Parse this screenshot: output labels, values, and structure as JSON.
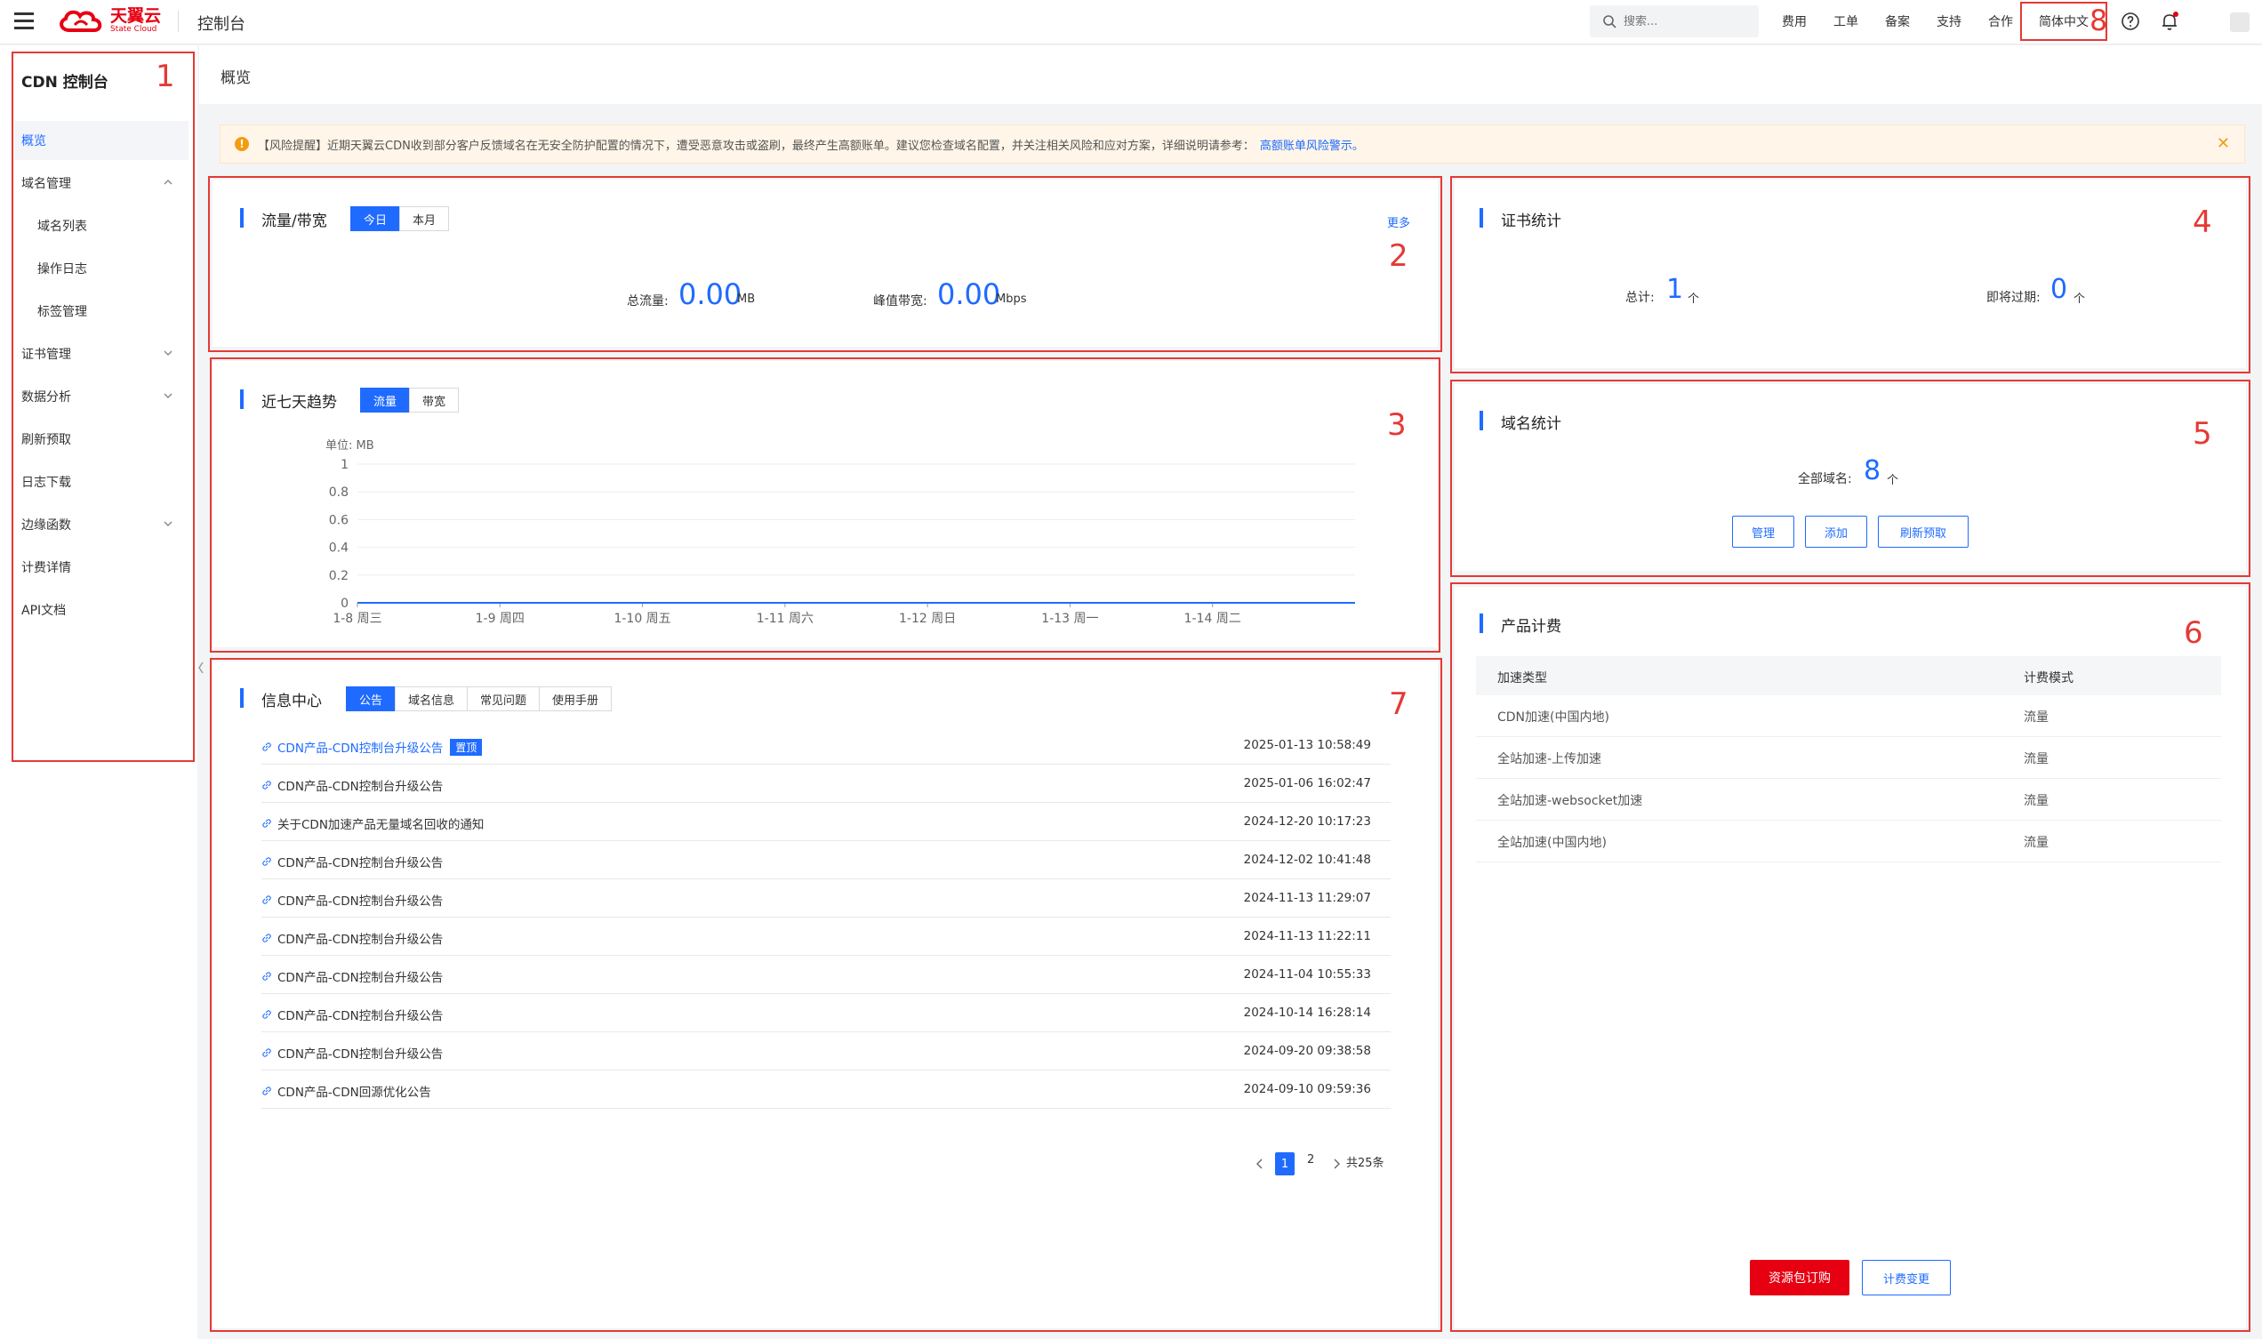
{
  "header": {
    "brand_cn": "天翼云",
    "brand_en": "State Cloud",
    "title": "控制台",
    "search_placeholder": "搜索...",
    "nav": [
      "费用",
      "工单",
      "备案",
      "支持",
      "合作"
    ],
    "language": "简体中文",
    "lang_annotation": "8"
  },
  "sidebar": {
    "title": "CDN 控制台",
    "annotation": "1",
    "items": [
      {
        "label": "概览",
        "active": true
      },
      {
        "label": "域名管理",
        "expanded": true
      },
      {
        "label": "域名列表",
        "sub": true
      },
      {
        "label": "操作日志",
        "sub": true
      },
      {
        "label": "标签管理",
        "sub": true
      },
      {
        "label": "证书管理",
        "expandable": true
      },
      {
        "label": "数据分析",
        "expandable": true
      },
      {
        "label": "刷新预取"
      },
      {
        "label": "日志下载"
      },
      {
        "label": "边缘函数",
        "expandable": true
      },
      {
        "label": "计费详情"
      },
      {
        "label": "API文档"
      }
    ]
  },
  "breadcrumb": "概览",
  "alert": {
    "text": "【风险提醒】近期天翼云CDN收到部分客户反馈域名在无安全防护配置的情况下，遭受恶意攻击或盗刷，最终产生高额账单。建议您检查域名配置，并关注相关风险和应对方案，详细说明请参考：",
    "link": "高额账单风险警示。"
  },
  "traffic": {
    "title": "流量/带宽",
    "annotation": "2",
    "tabs": [
      "今日",
      "本月"
    ],
    "more": "更多",
    "total_label": "总流量:",
    "total_value": "0.00",
    "total_unit": "MB",
    "peak_label": "峰值带宽:",
    "peak_value": "0.00",
    "peak_unit": "Mbps"
  },
  "trend": {
    "title": "近七天趋势",
    "annotation": "3",
    "tabs": [
      "流量",
      "带宽"
    ],
    "unit_label": "单位:  MB"
  },
  "chart_data": {
    "type": "line",
    "x": [
      "1-8 周三",
      "1-9 周四",
      "1-10 周五",
      "1-11 周六",
      "1-12 周日",
      "1-13 周一",
      "1-14 周二"
    ],
    "series": [
      {
        "values": [
          0,
          0,
          0,
          0,
          0,
          0,
          0
        ]
      }
    ],
    "ylabel": "单位:  MB",
    "yticks": [
      "1",
      "0.8",
      "0.6",
      "0.4",
      "0.2",
      "0"
    ],
    "ylim": [
      0,
      1
    ],
    "grid": true,
    "color": "#1f6bff"
  },
  "info": {
    "title": "信息中心",
    "annotation": "7",
    "tabs": [
      "公告",
      "域名信息",
      "常见问题",
      "使用手册"
    ],
    "pin_label": "置顶",
    "notices": [
      {
        "title": "CDN产品-CDN控制台升级公告",
        "date": "2025-01-13 10:58:49",
        "pinned": true,
        "link": true
      },
      {
        "title": "CDN产品-CDN控制台升级公告",
        "date": "2025-01-06 16:02:47"
      },
      {
        "title": "关于CDN加速产品无量域名回收的通知",
        "date": "2024-12-20 10:17:23"
      },
      {
        "title": "CDN产品-CDN控制台升级公告",
        "date": "2024-12-02 10:41:48"
      },
      {
        "title": "CDN产品-CDN控制台升级公告",
        "date": "2024-11-13 11:29:07"
      },
      {
        "title": "CDN产品-CDN控制台升级公告",
        "date": "2024-11-13 11:22:11"
      },
      {
        "title": "CDN产品-CDN控制台升级公告",
        "date": "2024-11-04 10:55:33"
      },
      {
        "title": "CDN产品-CDN控制台升级公告",
        "date": "2024-10-14 16:28:14"
      },
      {
        "title": "CDN产品-CDN控制台升级公告",
        "date": "2024-09-20 09:38:58"
      },
      {
        "title": "CDN产品-CDN回源优化公告",
        "date": "2024-09-10 09:59:36"
      }
    ],
    "pager": {
      "pages": [
        "1",
        "2"
      ],
      "total": "共25条"
    }
  },
  "cert": {
    "title": "证书统计",
    "annotation": "4",
    "total_label": "总计:",
    "total_value": "1",
    "expiring_label": "即将过期:",
    "expiring_value": "0",
    "unit": "个"
  },
  "domain": {
    "title": "域名统计",
    "annotation": "5",
    "all_label": "全部域名:",
    "all_value": "8",
    "unit": "个",
    "buttons": [
      "管理",
      "添加",
      "刷新预取"
    ]
  },
  "billing": {
    "title": "产品计费",
    "annotation": "6",
    "columns": [
      "加速类型",
      "计费模式"
    ],
    "rows": [
      [
        "CDN加速(中国内地)",
        "流量"
      ],
      [
        "全站加速-上传加速",
        "流量"
      ],
      [
        "全站加速-websocket加速",
        "流量"
      ],
      [
        "全站加速(中国内地)",
        "流量"
      ]
    ],
    "buttons": [
      "资源包订购",
      "计费变更"
    ]
  },
  "colors": {
    "accent": "#1f6bff",
    "brand": "#e60012",
    "annotation": "#e53935"
  }
}
